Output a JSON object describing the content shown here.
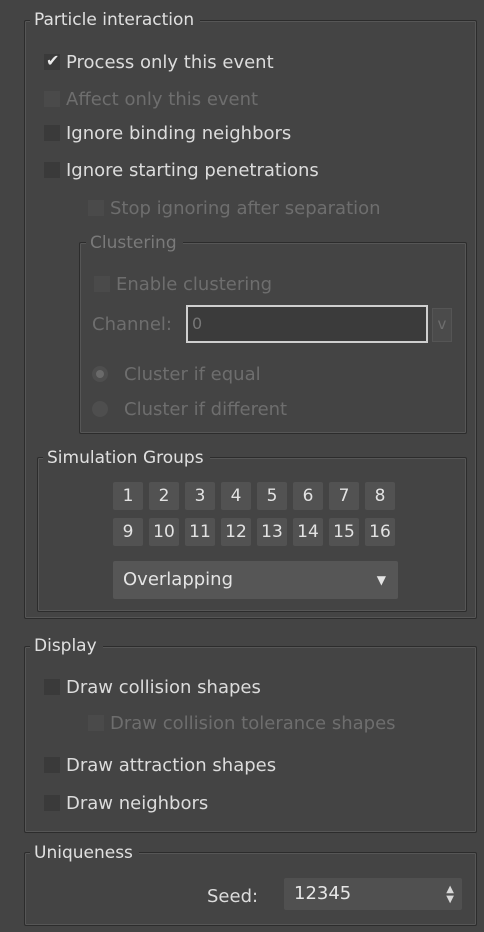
{
  "particle_interaction": {
    "legend": "Particle interaction",
    "process_only": "Process only this event",
    "affect_only": "Affect only this event",
    "ignore_binding": "Ignore binding neighbors",
    "ignore_starting": "Ignore starting penetrations",
    "stop_ignoring": "Stop ignoring after separation",
    "clustering": {
      "legend": "Clustering",
      "enable": "Enable clustering",
      "channel_label": "Channel:",
      "channel_value": "0",
      "v_button": "v",
      "cluster_equal": "Cluster if equal",
      "cluster_different": "Cluster if different"
    },
    "simulation_groups": {
      "legend": "Simulation Groups",
      "buttons": [
        "1",
        "2",
        "3",
        "4",
        "5",
        "6",
        "7",
        "8",
        "9",
        "10",
        "11",
        "12",
        "13",
        "14",
        "15",
        "16"
      ],
      "mode": "Overlapping"
    }
  },
  "display": {
    "legend": "Display",
    "draw_collision": "Draw collision shapes",
    "draw_tolerance": "Draw collision tolerance shapes",
    "draw_attraction": "Draw attraction shapes",
    "draw_neighbors": "Draw neighbors"
  },
  "uniqueness": {
    "legend": "Uniqueness",
    "seed_label": "Seed:",
    "seed_value": "12345"
  },
  "icons": {
    "check": "checkmark-icon",
    "dropdown": "triangle-down-icon",
    "spinner": "updown-arrows-icon"
  }
}
